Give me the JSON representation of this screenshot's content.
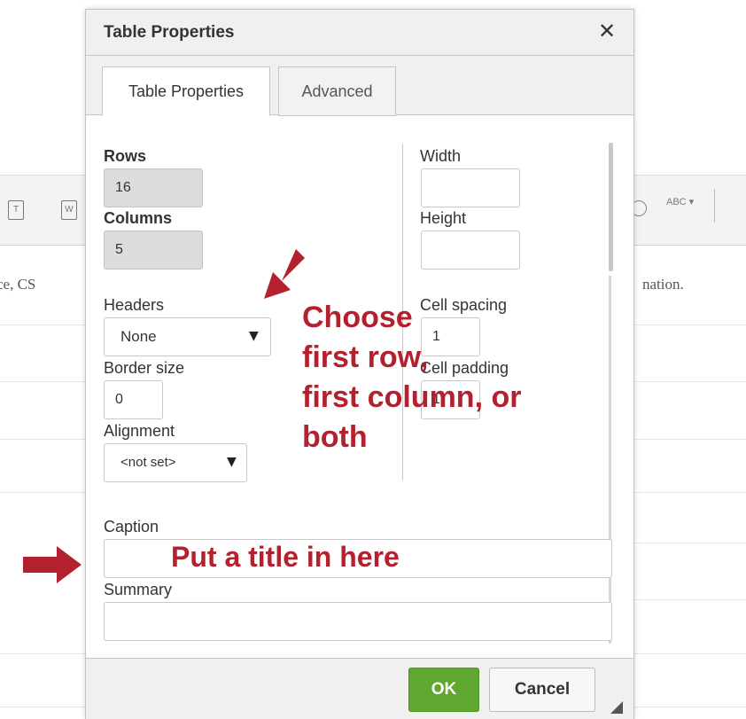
{
  "background": {
    "left_text": "ce, CS",
    "right_text": "nation.",
    "toolbar_spellcheck": "ABC",
    "toolbar_icons": [
      "paste-text-icon",
      "paste-word-icon",
      "circle-icon",
      "spellcheck-icon"
    ]
  },
  "dialog": {
    "title": "Table Properties",
    "close_glyph": "✕",
    "tabs": [
      {
        "label": "Table Properties",
        "active": true
      },
      {
        "label": "Advanced",
        "active": false
      }
    ],
    "left": {
      "rows_label": "Rows",
      "rows_value": "16",
      "columns_label": "Columns",
      "columns_value": "5",
      "headers_label": "Headers",
      "headers_value": "None",
      "border_label": "Border size",
      "border_value": "0",
      "alignment_label": "Alignment",
      "alignment_value": "<not set>"
    },
    "right": {
      "width_label": "Width",
      "width_value": "",
      "height_label": "Height",
      "height_value": "",
      "cell_spacing_label": "Cell spacing",
      "cell_spacing_value": "1",
      "cell_padding_label": "Cell padding",
      "cell_padding_value": "1"
    },
    "caption_label": "Caption",
    "caption_value": "",
    "summary_label": "Summary",
    "summary_value": "",
    "ok_label": "OK",
    "cancel_label": "Cancel"
  },
  "annotations": {
    "headers_note_lines": [
      "Choose",
      "first row,",
      "first column, or",
      "both"
    ],
    "caption_note": "Put a title in here",
    "arrow_color": "#b3202e"
  },
  "colors": {
    "ok_green": "#5fa72f",
    "annotation_red": "#b3202e",
    "dialog_header_bg": "#f0f0f0"
  }
}
